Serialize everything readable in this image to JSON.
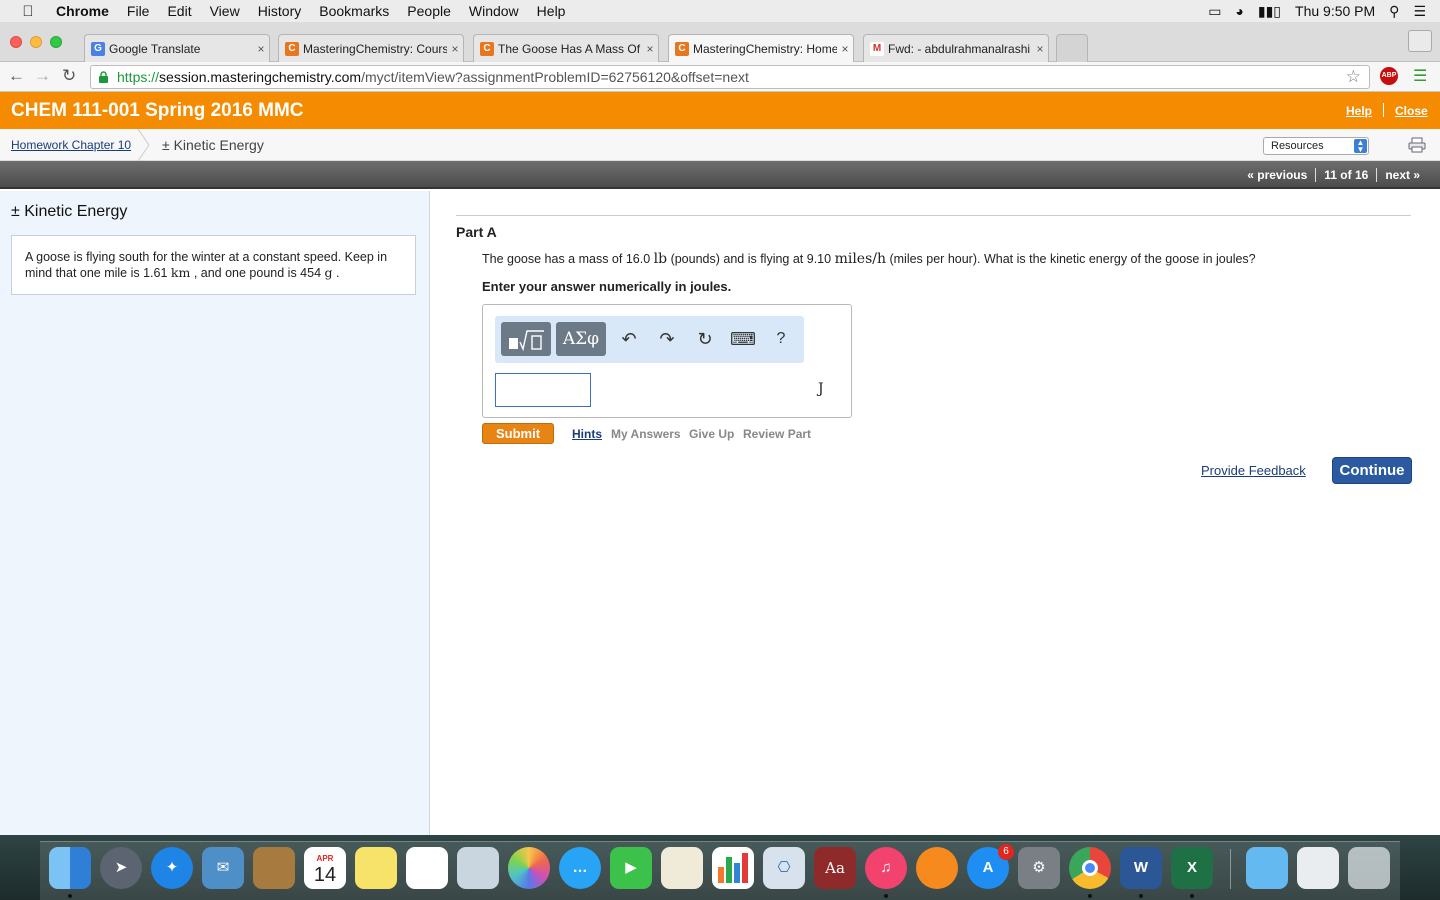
{
  "menubar": {
    "items": [
      "Chrome",
      "File",
      "Edit",
      "View",
      "History",
      "Bookmarks",
      "People",
      "Window",
      "Help"
    ],
    "clock": "Thu 9:50 PM"
  },
  "tabs": [
    {
      "label": "Google Translate",
      "fav_color": "#4a80e8",
      "fav_glyph": "G"
    },
    {
      "label": "MasteringChemistry: Cours",
      "fav_color": "#e8761c",
      "fav_glyph": "C"
    },
    {
      "label": "The Goose Has A Mass Of",
      "fav_color": "#e8761c",
      "fav_glyph": "C"
    },
    {
      "label": "MasteringChemistry: Home",
      "fav_color": "#e8761c",
      "fav_glyph": "C"
    },
    {
      "label": "Fwd: - abdulrahmanalrashi",
      "fav_color": "#ffffff",
      "fav_glyph": "M"
    }
  ],
  "address": {
    "scheme": "https://",
    "host": "session.masteringchemistry.com",
    "path": "/myct/itemView?assignmentProblemID=62756120&offset=next"
  },
  "course": {
    "title": "CHEM 111-001 Spring 2016 MMC",
    "help": "Help",
    "close": "Close"
  },
  "breadcrumb": {
    "parent": "Homework Chapter 10",
    "current": "± Kinetic Energy",
    "resources": "Resources"
  },
  "pager": {
    "previous": "« previous",
    "position": "11 of 16",
    "next": "next »"
  },
  "problem": {
    "title": "± Kinetic Energy",
    "intro_1": "A goose is flying south for the winter at a constant speed. Keep in mind that one mile is 1.61 ",
    "intro_km": "km",
    "intro_2": " , and one pound is 454 ",
    "intro_g": "g",
    "intro_3": " ."
  },
  "part": {
    "title": "Part A",
    "q_1": "The goose has a mass of 16.0 ",
    "q_lb": "lb",
    "q_2": " (pounds) and is flying at 9.10 ",
    "q_mph": "miles/h",
    "q_3": " (miles per hour). What is the kinetic energy of the goose in joules?",
    "instruction": "Enter your answer numerically in joules.",
    "unit": "J",
    "greek": "ΑΣφ",
    "help_glyph": "?"
  },
  "actions": {
    "submit": "Submit",
    "hints": "Hints",
    "my_answers": "My Answers",
    "give_up": "Give Up",
    "review_part": "Review Part",
    "feedback": "Provide Feedback",
    "continue": "Continue"
  },
  "dock": {
    "calendar_month": "APR",
    "calendar_day": "14",
    "dictionary": "Aa",
    "word": "W",
    "excel": "X",
    "appstore_badge": "6"
  },
  "colors": {
    "accent_orange": "#f58b00",
    "link_blue": "#1a3d7a",
    "continue_blue": "#2b5aa0"
  }
}
